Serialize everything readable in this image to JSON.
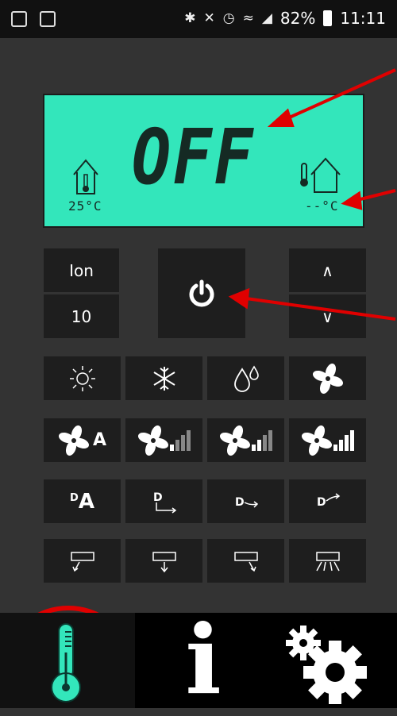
{
  "status_bar": {
    "battery": "82%",
    "time": "11:11"
  },
  "display": {
    "mode_text": "OFF",
    "indoor_temp": "25°C",
    "outdoor_temp": "--°C"
  },
  "controls": {
    "ion_label": "Ion",
    "timer_value": "10",
    "temp_up_label": "∧",
    "temp_down_label": "∨",
    "power_icon": "power-icon"
  },
  "modes": [
    "sun-icon",
    "snowflake-icon",
    "drops-icon",
    "fan-icon"
  ],
  "fan_speed": {
    "auto_label": "A",
    "speeds": [
      "fan-speed-low",
      "fan-speed-medium",
      "fan-speed-high"
    ]
  },
  "swing": {
    "auto_label": "A",
    "prefix": "D"
  },
  "nav": {
    "tabs": [
      "thermometer-icon",
      "info-icon",
      "gears-icon"
    ],
    "info_glyph": "i"
  },
  "colors": {
    "lcd_background": "#33e6bb",
    "accent": "#33e6bb",
    "annotation_red": "#e00000"
  }
}
